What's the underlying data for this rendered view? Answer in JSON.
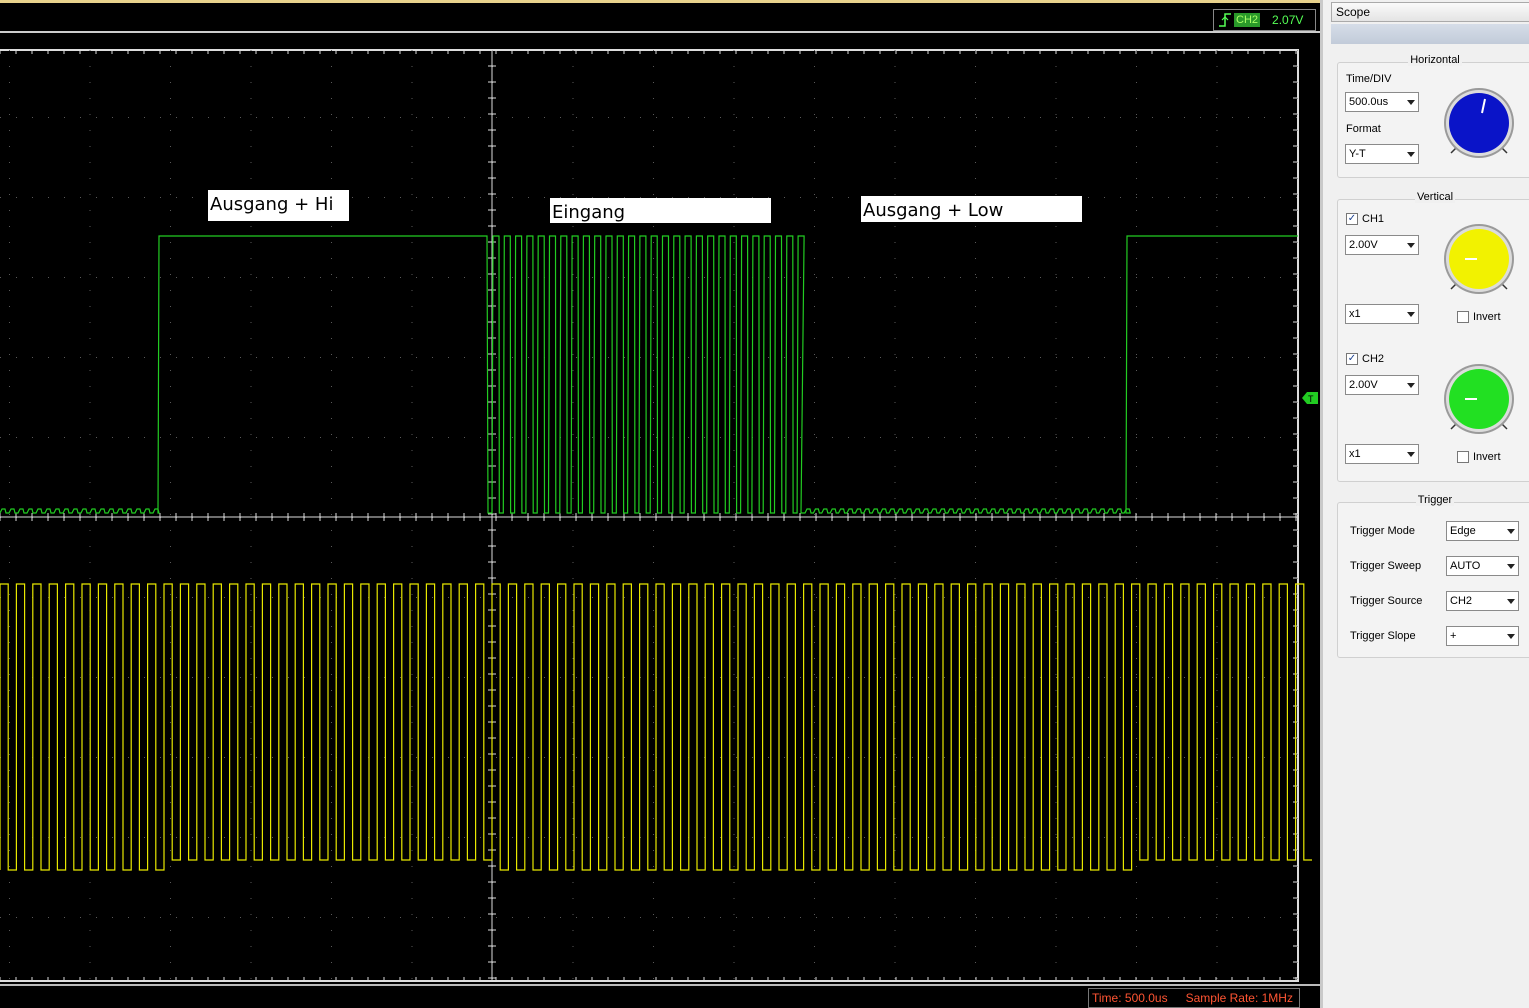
{
  "top_bar": {
    "trigger_channel": "CH2",
    "trigger_level": "2.07V"
  },
  "annotations": {
    "label_1": "Ausgang + Hi",
    "label_2": "Eingang",
    "label_3": "Ausgang + Low"
  },
  "status": {
    "time": "Time: 500.0us",
    "sample_rate": "Sample Rate: 1MHz"
  },
  "channel_marker": "T",
  "colors": {
    "ch1": "#e8e800",
    "ch2": "#22cc22",
    "grid": "#5a5a5a",
    "status_text": "#ff5533"
  },
  "panel": {
    "title": "Scope",
    "horizontal": {
      "title": "Horizontal",
      "time_div_label": "Time/DIV",
      "time_div_value": "500.0us",
      "format_label": "Format",
      "format_value": "Y-T"
    },
    "vertical": {
      "title": "Vertical",
      "ch1_label": "CH1",
      "ch1_volt": "2.00V",
      "ch1_probe": "x1",
      "ch1_invert": "Invert",
      "ch2_label": "CH2",
      "ch2_volt": "2.00V",
      "ch2_probe": "x1",
      "ch2_invert": "Invert"
    },
    "trigger": {
      "title": "Trigger",
      "mode_label": "Trigger Mode",
      "mode_value": "Edge",
      "sweep_label": "Trigger Sweep",
      "sweep_value": "AUTO",
      "source_label": "Trigger Source",
      "source_value": "CH2",
      "slope_label": "Trigger Slope",
      "slope_value": "+"
    }
  }
}
